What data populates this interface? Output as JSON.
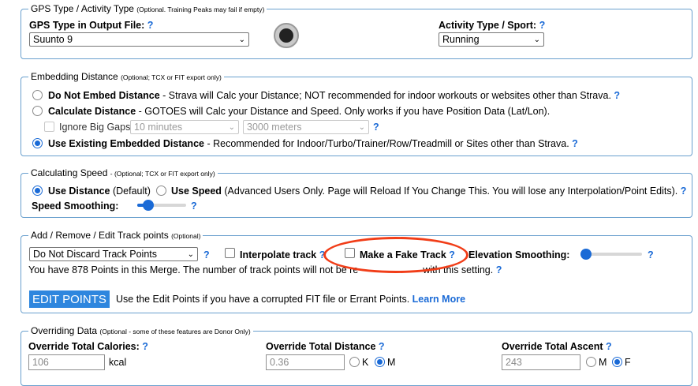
{
  "gps": {
    "legend": "GPS Type / Activity Type",
    "legend_note": "(Optional. Training Peaks may fail if empty)",
    "gps_label": "GPS Type in Output File:",
    "gps_value": "Suunto 9",
    "sport_label": "Activity Type / Sport:",
    "sport_value": "Running",
    "help": "?"
  },
  "embed": {
    "legend": "Embedding Distance",
    "legend_note": "(Optional; TCX or FIT export only)",
    "opt1_title": "Do Not Embed Distance",
    "opt1_desc": " - Strava will Calc your Distance; NOT recommended for indoor workouts or websites other than Strava.",
    "opt2_title": "Calculate Distance",
    "opt2_desc": " - GOTOES will Calc your Distance and Speed. Only works if you have Position Data (Lat/Lon).",
    "ignore_gaps": "Ignore Big Gaps",
    "gap_time": "10 minutes",
    "gap_dist": "3000 meters",
    "opt3_title": "Use Existing Embedded Distance",
    "opt3_desc": " - Recommended for Indoor/Turbo/Trainer/Row/Treadmill or Sites other than Strava.",
    "help": "?"
  },
  "speed": {
    "legend": "Calculating Speed",
    "legend_note": "- (Optional; TCX or FIT export only)",
    "use_distance": "Use Distance",
    "use_distance_note": " (Default)",
    "use_speed": "Use Speed",
    "use_speed_note": " (Advanced Users Only. Page will Reload If You Change This. You will lose any Interpolation/Point Edits).",
    "smoothing_label": "Speed Smoothing:",
    "smoothing_level": 0.15,
    "help": "?"
  },
  "track": {
    "legend": "Add / Remove / Edit Track points",
    "legend_note": "(Optional)",
    "discard_value": "Do Not Discard Track Points",
    "interpolate": "Interpolate track",
    "fake_track": "Make a Fake Track",
    "elev_label": "Elevation Smoothing:",
    "elev_level": 0.0,
    "points_info_a": "You have 878 Points in this Merge. The number of track points will not be re",
    "points_info_b": "with this setting.",
    "edit_button": "EDIT POINTS",
    "edit_desc": "Use the Edit Points if you have a corrupted FIT file or Errant Points.",
    "learn_more": "Learn More",
    "help": "?"
  },
  "override": {
    "legend": "Overriding Data",
    "legend_note": "(Optional - some of these features are Donor Only)",
    "cal_label": "Override Total Calories:",
    "cal_value": "106",
    "cal_unit": "kcal",
    "dist_label": "Override Total Distance",
    "dist_value": "0.36",
    "dist_unit_k": "K",
    "dist_unit_m": "M",
    "ascent_label": "Override Total Ascent",
    "ascent_value": "243",
    "asc_unit_m": "M",
    "asc_unit_f": "F",
    "help": "?"
  },
  "colors": {
    "accent": "#1a6ad6",
    "highlight_oval": "#f13d18",
    "fieldset_border": "#6aa0ce"
  }
}
